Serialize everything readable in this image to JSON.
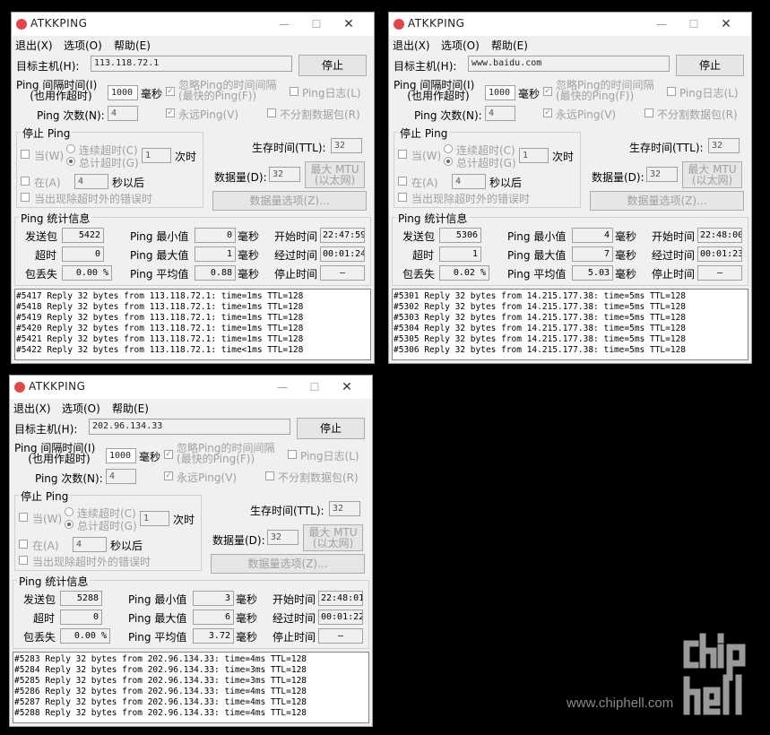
{
  "menu": {
    "exit": "退出(X)",
    "options": "选项(O)",
    "help": "帮助(E)"
  },
  "title": "ATKKPING",
  "labels": {
    "target": "目标主机(H):",
    "stop_btn": "停止",
    "interval1": "Ping 间隔时间(I)",
    "interval2": "(也用作超时)",
    "ms": "毫秒",
    "ignore1": "忽略Ping的时间间隔",
    "ignore2": "(最快的Ping(F))",
    "pinglog": "Ping日志(L)",
    "count": "Ping 次数(N):",
    "forever": "永远Ping(V)",
    "nofrag": "不分割数据包(R)",
    "stop_group": "停止 Ping",
    "when": "当(W)",
    "consec": "连续超时(C)",
    "total": "总计超时(G)",
    "times": "次时",
    "at": "在(A)",
    "seconds_after": "秒以后",
    "on_error": "当出现除超时外的错误时",
    "ttl": "生存时间(TTL):",
    "datasize": "数据量(D):",
    "maxmtu1": "最大 MTU",
    "maxmtu2": "(以太网)",
    "dataopts": "数据量选项(Z)...",
    "stats_group": "Ping 统计信息",
    "sent": "发送包",
    "timeout": "超时",
    "loss": "包丢失",
    "min": "Ping 最小值",
    "max": "Ping 最大值",
    "avg": "Ping 平均值",
    "start": "开始时间",
    "elapsed": "经过时间",
    "stoptime": "停止时间"
  },
  "windows": [
    {
      "host": "113.118.72.1",
      "interval": "1000",
      "count": "4",
      "when_n": "1",
      "at_n": "4",
      "ttl": "32",
      "datasize": "32",
      "sent": "5422",
      "timeout": "0",
      "loss": "0.00 %",
      "min": "0",
      "max": "1",
      "avg": "0.88",
      "start": "22:47:59",
      "elapsed": "00:01:24",
      "stoptime": "—",
      "log": [
        "#5417 Reply 32 bytes from 113.118.72.1: time=1ms TTL=128",
        "#5418 Reply 32 bytes from 113.118.72.1: time=1ms TTL=128",
        "#5419 Reply 32 bytes from 113.118.72.1: time=1ms TTL=128",
        "#5420 Reply 32 bytes from 113.118.72.1: time=1ms TTL=128",
        "#5421 Reply 32 bytes from 113.118.72.1: time=1ms TTL=128",
        "#5422 Reply 32 bytes from 113.118.72.1: time<1ms TTL=128"
      ]
    },
    {
      "host": "www.baidu.com",
      "interval": "1000",
      "count": "4",
      "when_n": "1",
      "at_n": "4",
      "ttl": "32",
      "datasize": "32",
      "sent": "5306",
      "timeout": "1",
      "loss": "0.02 %",
      "min": "4",
      "max": "7",
      "avg": "5.03",
      "start": "22:48:00",
      "elapsed": "00:01:23",
      "stoptime": "—",
      "log": [
        "#5301 Reply 32 bytes from 14.215.177.38: time=5ms TTL=128",
        "#5302 Reply 32 bytes from 14.215.177.38: time=5ms TTL=128",
        "#5303 Reply 32 bytes from 14.215.177.38: time=5ms TTL=128",
        "#5304 Reply 32 bytes from 14.215.177.38: time=5ms TTL=128",
        "#5305 Reply 32 bytes from 14.215.177.38: time=5ms TTL=128",
        "#5306 Reply 32 bytes from 14.215.177.38: time=5ms TTL=128"
      ]
    },
    {
      "host": "202.96.134.33",
      "interval": "1000",
      "count": "4",
      "when_n": "1",
      "at_n": "4",
      "ttl": "32",
      "datasize": "32",
      "sent": "5288",
      "timeout": "0",
      "loss": "0.00 %",
      "min": "3",
      "max": "6",
      "avg": "3.72",
      "start": "22:48:01",
      "elapsed": "00:01:22",
      "stoptime": "—",
      "log": [
        "#5283 Reply 32 bytes from 202.96.134.33: time=4ms TTL=128",
        "#5284 Reply 32 bytes from 202.96.134.33: time=3ms TTL=128",
        "#5285 Reply 32 bytes from 202.96.134.33: time=3ms TTL=128",
        "#5286 Reply 32 bytes from 202.96.134.33: time=4ms TTL=128",
        "#5287 Reply 32 bytes from 202.96.134.33: time=4ms TTL=128",
        "#5288 Reply 32 bytes from 202.96.134.33: time=4ms TTL=128"
      ]
    }
  ],
  "watermark": {
    "logo": "chip hell",
    "url": "www.chiphell.com"
  },
  "colors": {
    "window_bg": "#f0f0f0",
    "app_icon": "#e34848",
    "desktop": "#000000"
  }
}
